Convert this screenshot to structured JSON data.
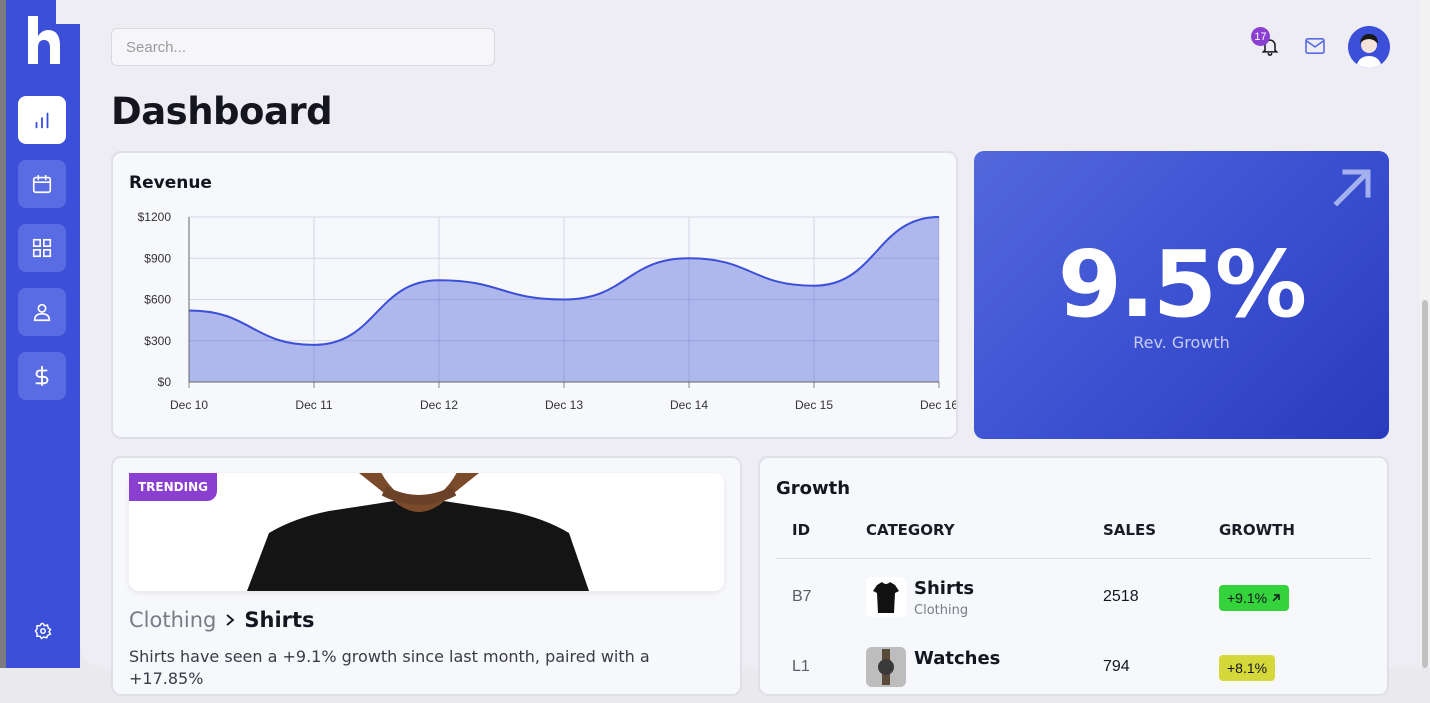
{
  "sidebar": {
    "items": [
      {
        "name": "analytics",
        "icon": "bar-chart-icon",
        "active": true
      },
      {
        "name": "calendar",
        "icon": "calendar-icon",
        "active": false
      },
      {
        "name": "apps",
        "icon": "grid-icon",
        "active": false
      },
      {
        "name": "users",
        "icon": "user-icon",
        "active": false
      },
      {
        "name": "finance",
        "icon": "dollar-icon",
        "active": false
      }
    ],
    "settings_icon": "gear-icon",
    "brand_color": "#3b4fd8"
  },
  "header": {
    "search_placeholder": "Search...",
    "notification_count": "17",
    "notification_icon": "bell-icon",
    "mail_icon": "mail-icon"
  },
  "page_title": "Dashboard",
  "revenue": {
    "title": "Revenue",
    "chart_data": {
      "type": "area",
      "categories": [
        "Dec 10",
        "Dec 11",
        "Dec 12",
        "Dec 13",
        "Dec 14",
        "Dec 15",
        "Dec 16"
      ],
      "values": [
        520,
        270,
        740,
        600,
        900,
        700,
        1200
      ],
      "yticks": [
        "$0",
        "$300",
        "$600",
        "$900",
        "$1200"
      ],
      "ylim": [
        0,
        1200
      ],
      "grid": true,
      "color": "#3b4fd8"
    }
  },
  "kpi": {
    "value": "9.5%",
    "label": "Rev. Growth",
    "arrow_icon": "arrow-up-right-icon"
  },
  "trending": {
    "badge": "TRENDING",
    "crumb_parent": "Clothing",
    "crumb_current": "Shirts",
    "description": "Shirts have seen a +9.1% growth since last month, paired with a +17.85%"
  },
  "growth": {
    "title": "Growth",
    "columns": [
      "ID",
      "CATEGORY",
      "SALES",
      "GROWTH"
    ],
    "rows": [
      {
        "id": "B7",
        "category": "Shirts",
        "subcategory": "Clothing",
        "sales": "2518",
        "growth": "+9.1%",
        "color": "#34d23b"
      },
      {
        "id": "L1",
        "category": "Watches",
        "subcategory": "",
        "sales": "794",
        "growth": "+8.1%",
        "color": "#d4d83a"
      }
    ]
  }
}
